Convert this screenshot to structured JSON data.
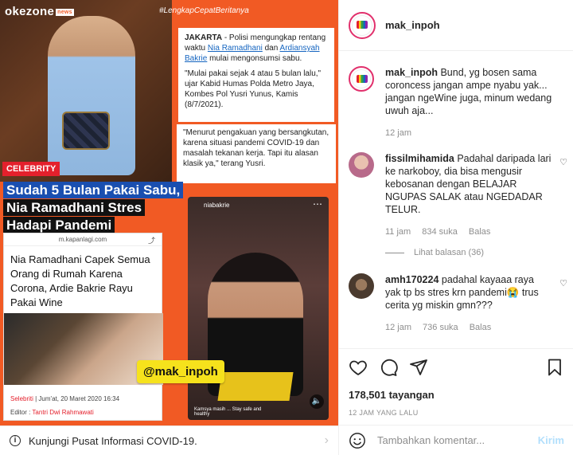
{
  "media": {
    "brand": "okezone",
    "brand_box": "news",
    "hashtag": "#LengkapCepatBeritanya",
    "category_badge": "CELEBRITY",
    "article": {
      "city": "JAKARTA",
      "lead_pre": " - Polisi mengungkap rentang waktu ",
      "link1": "Nia Ramadhani",
      "mid": " dan ",
      "link2": "Ardiansyah Bakrie",
      "lead_post": " mulai mengonsumsi sabu.",
      "quote1": "\"Mulai pakai sejak 4 atau 5 bulan lalu,\" ujar Kabid Humas Polda Metro Jaya, Kombes Pol Yusri Yunus, Kamis (8/7/2021).",
      "quote2": "\"Menurut pengakuan yang bersangkutan, karena situasi pandemi COVID-19 dan masalah tekanan kerja. Tapi itu alasan klasik ya,\" terang Yusri."
    },
    "headline": {
      "line1": "Sudah 5 Bulan Pakai Sabu,",
      "line2": "Nia Ramadhani Stres",
      "line3": "Hadapi Pandemi"
    },
    "kapanlagi": {
      "url": "m.kapanlagi.com",
      "title": "Nia Ramadhani Capek Semua Orang di Rumah Karena Corona, Ardie Bakrie Rayu Pakai Wine",
      "category": "Selebriti",
      "date": " | Jum'at, 20 Maret 2020 16:34",
      "editor_label": "Editor : ",
      "editor_name": "Tantri Dwi Rahmawati"
    },
    "video": {
      "user": "niabakrie",
      "caption": "Kamsya masih ... Stay safe and healthy"
    },
    "watermark": "@mak_inpoh"
  },
  "covid_bar": {
    "text": "Kunjungi Pusat Informasi COVID-19."
  },
  "sidebar": {
    "username": "mak_inpoh",
    "caption": {
      "user": "mak_inpoh",
      "text": " Bund, yg bosen sama coroncess jangan ampe nyabu yak... jangan ngeWine juga, minum wedang uwuh aja...",
      "time": "12 jam"
    },
    "comments": [
      {
        "user": "fissilmihamida",
        "text": " Padahal daripada lari ke narkoboy, dia bisa mengusir kebosanan dengan BELAJAR NGUPAS SALAK atau NGEDADAR TELUR.",
        "time": "11 jam",
        "likes": "834 suka",
        "reply": "Balas",
        "view_replies": "Lihat balasan (36)"
      },
      {
        "user": "amh170224",
        "text": " padahal kayaaa raya yak tp bs stres krn pandemi😭 trus cerita yg miskin gmn???",
        "time": "12 jam",
        "likes": "736 suka",
        "reply": "Balas"
      }
    ],
    "views": "178,501 tayangan",
    "time_ago": "12 JAM YANG LALU",
    "comment_placeholder": "Tambahkan komentar...",
    "send_label": "Kirim"
  },
  "colors": {
    "accent_orange": "#f15a24",
    "instagram_link": "#b2dffc",
    "muted": "#8e8e8e"
  }
}
